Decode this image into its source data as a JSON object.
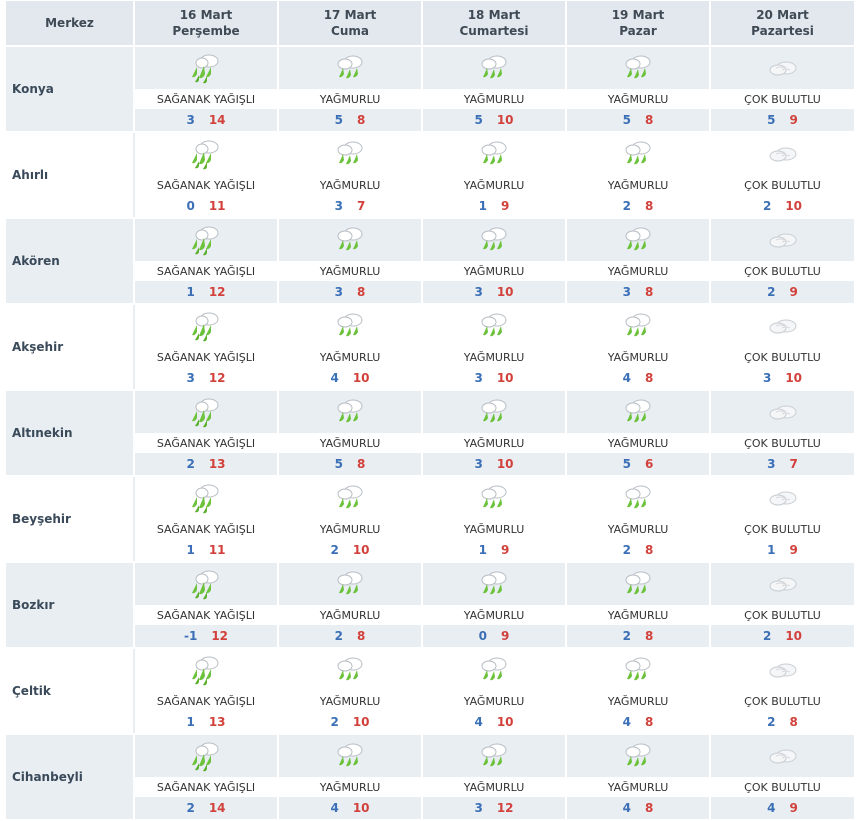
{
  "header": {
    "region_label": "Merkez",
    "days": [
      {
        "date": "16 Mart",
        "weekday": "Perşembe"
      },
      {
        "date": "17 Mart",
        "weekday": "Cuma"
      },
      {
        "date": "18 Mart",
        "weekday": "Cumartesi"
      },
      {
        "date": "19 Mart",
        "weekday": "Pazar"
      },
      {
        "date": "20 Mart",
        "weekday": "Pazartesi"
      }
    ]
  },
  "rows": [
    {
      "city": "Konya",
      "forecasts": [
        {
          "icon": "heavy-rain-icon",
          "desc": "SAĞANAK YAĞIŞLI",
          "min": "3",
          "max": "14"
        },
        {
          "icon": "rain-icon",
          "desc": "YAĞMURLU",
          "min": "5",
          "max": "8"
        },
        {
          "icon": "rain-icon",
          "desc": "YAĞMURLU",
          "min": "5",
          "max": "10"
        },
        {
          "icon": "rain-icon",
          "desc": "YAĞMURLU",
          "min": "5",
          "max": "8"
        },
        {
          "icon": "cloud-icon",
          "desc": "ÇOK BULUTLU",
          "min": "5",
          "max": "9"
        }
      ]
    },
    {
      "city": "Ahırlı",
      "forecasts": [
        {
          "icon": "heavy-rain-icon",
          "desc": "SAĞANAK YAĞIŞLI",
          "min": "0",
          "max": "11"
        },
        {
          "icon": "rain-icon",
          "desc": "YAĞMURLU",
          "min": "3",
          "max": "7"
        },
        {
          "icon": "rain-icon",
          "desc": "YAĞMURLU",
          "min": "1",
          "max": "9"
        },
        {
          "icon": "rain-icon",
          "desc": "YAĞMURLU",
          "min": "2",
          "max": "8"
        },
        {
          "icon": "cloud-icon",
          "desc": "ÇOK BULUTLU",
          "min": "2",
          "max": "10"
        }
      ]
    },
    {
      "city": "Akören",
      "forecasts": [
        {
          "icon": "heavy-rain-icon",
          "desc": "SAĞANAK YAĞIŞLI",
          "min": "1",
          "max": "12"
        },
        {
          "icon": "rain-icon",
          "desc": "YAĞMURLU",
          "min": "3",
          "max": "8"
        },
        {
          "icon": "rain-icon",
          "desc": "YAĞMURLU",
          "min": "3",
          "max": "10"
        },
        {
          "icon": "rain-icon",
          "desc": "YAĞMURLU",
          "min": "3",
          "max": "8"
        },
        {
          "icon": "cloud-icon",
          "desc": "ÇOK BULUTLU",
          "min": "2",
          "max": "9"
        }
      ]
    },
    {
      "city": "Akşehir",
      "forecasts": [
        {
          "icon": "heavy-rain-icon",
          "desc": "SAĞANAK YAĞIŞLI",
          "min": "3",
          "max": "12"
        },
        {
          "icon": "rain-icon",
          "desc": "YAĞMURLU",
          "min": "4",
          "max": "10"
        },
        {
          "icon": "rain-icon",
          "desc": "YAĞMURLU",
          "min": "3",
          "max": "10"
        },
        {
          "icon": "rain-icon",
          "desc": "YAĞMURLU",
          "min": "4",
          "max": "8"
        },
        {
          "icon": "cloud-icon",
          "desc": "ÇOK BULUTLU",
          "min": "3",
          "max": "10"
        }
      ]
    },
    {
      "city": "Altınekin",
      "forecasts": [
        {
          "icon": "heavy-rain-icon",
          "desc": "SAĞANAK YAĞIŞLI",
          "min": "2",
          "max": "13"
        },
        {
          "icon": "rain-icon",
          "desc": "YAĞMURLU",
          "min": "5",
          "max": "8"
        },
        {
          "icon": "rain-icon",
          "desc": "YAĞMURLU",
          "min": "3",
          "max": "10"
        },
        {
          "icon": "rain-icon",
          "desc": "YAĞMURLU",
          "min": "5",
          "max": "6"
        },
        {
          "icon": "cloud-icon",
          "desc": "ÇOK BULUTLU",
          "min": "3",
          "max": "7"
        }
      ]
    },
    {
      "city": "Beyşehir",
      "forecasts": [
        {
          "icon": "heavy-rain-icon",
          "desc": "SAĞANAK YAĞIŞLI",
          "min": "1",
          "max": "11"
        },
        {
          "icon": "rain-icon",
          "desc": "YAĞMURLU",
          "min": "2",
          "max": "10"
        },
        {
          "icon": "rain-icon",
          "desc": "YAĞMURLU",
          "min": "1",
          "max": "9"
        },
        {
          "icon": "rain-icon",
          "desc": "YAĞMURLU",
          "min": "2",
          "max": "8"
        },
        {
          "icon": "cloud-icon",
          "desc": "ÇOK BULUTLU",
          "min": "1",
          "max": "9"
        }
      ]
    },
    {
      "city": "Bozkır",
      "forecasts": [
        {
          "icon": "heavy-rain-icon",
          "desc": "SAĞANAK YAĞIŞLI",
          "min": "-1",
          "max": "12"
        },
        {
          "icon": "rain-icon",
          "desc": "YAĞMURLU",
          "min": "2",
          "max": "8"
        },
        {
          "icon": "rain-icon",
          "desc": "YAĞMURLU",
          "min": "0",
          "max": "9"
        },
        {
          "icon": "rain-icon",
          "desc": "YAĞMURLU",
          "min": "2",
          "max": "8"
        },
        {
          "icon": "cloud-icon",
          "desc": "ÇOK BULUTLU",
          "min": "2",
          "max": "10"
        }
      ]
    },
    {
      "city": "Çeltik",
      "forecasts": [
        {
          "icon": "heavy-rain-icon",
          "desc": "SAĞANAK YAĞIŞLI",
          "min": "1",
          "max": "13"
        },
        {
          "icon": "rain-icon",
          "desc": "YAĞMURLU",
          "min": "2",
          "max": "10"
        },
        {
          "icon": "rain-icon",
          "desc": "YAĞMURLU",
          "min": "4",
          "max": "10"
        },
        {
          "icon": "rain-icon",
          "desc": "YAĞMURLU",
          "min": "4",
          "max": "8"
        },
        {
          "icon": "cloud-icon",
          "desc": "ÇOK BULUTLU",
          "min": "2",
          "max": "8"
        }
      ]
    },
    {
      "city": "Cihanbeyli",
      "forecasts": [
        {
          "icon": "heavy-rain-icon",
          "desc": "SAĞANAK YAĞIŞLI",
          "min": "2",
          "max": "14"
        },
        {
          "icon": "rain-icon",
          "desc": "YAĞMURLU",
          "min": "4",
          "max": "10"
        },
        {
          "icon": "rain-icon",
          "desc": "YAĞMURLU",
          "min": "3",
          "max": "12"
        },
        {
          "icon": "rain-icon",
          "desc": "YAĞMURLU",
          "min": "4",
          "max": "8"
        },
        {
          "icon": "cloud-icon",
          "desc": "ÇOK BULUTLU",
          "min": "4",
          "max": "9"
        }
      ]
    }
  ],
  "colors": {
    "min_temp": "#3b6fb6",
    "max_temp": "#d2413b",
    "header_bg": "#e2e8ee",
    "shade_bg": "#e9eef3",
    "rain_green": "#6cc23a",
    "cloud_grey": "#c9ced3"
  }
}
